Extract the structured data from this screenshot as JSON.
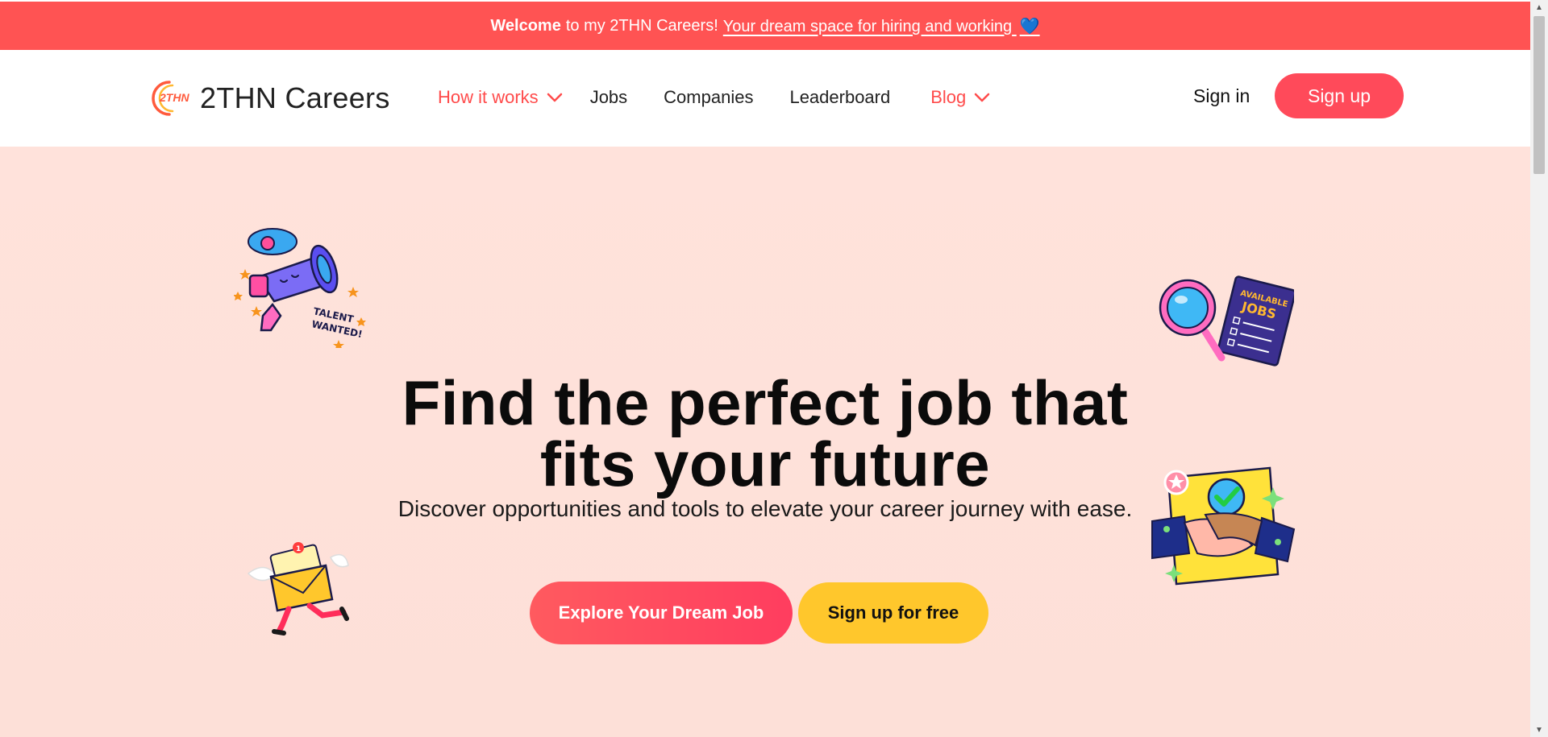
{
  "announcement": {
    "bold": "Welcome",
    "text": "to my 2THN Careers!",
    "link": "Your dream space for hiring and working",
    "heart": "💙"
  },
  "header": {
    "logo_text": "2THN Careers",
    "logo_mark": "2THN",
    "nav": [
      {
        "label": "How it works",
        "has_dropdown": true,
        "accent": true
      },
      {
        "label": "Jobs"
      },
      {
        "label": "Companies"
      },
      {
        "label": "Leaderboard"
      },
      {
        "label": "Blog",
        "has_dropdown": true,
        "accent": true
      }
    ],
    "signin": "Sign in",
    "signup": "Sign up"
  },
  "hero": {
    "title_line1": "Find the perfect job that",
    "title_line2": "fits your future",
    "subtitle": "Discover opportunities and tools to elevate your career journey with ease.",
    "cta_primary": "Explore Your Dream Job",
    "cta_secondary": "Sign up for free",
    "sticker_megaphone_text": "TALENT WANTED!",
    "sticker_jobs_text": "AVAILABLE JOBS",
    "mail_badge": "1"
  },
  "colors": {
    "brand": "#ff4b4b",
    "announcement_bg": "#ff5353",
    "signup_bg": "#ff4a5a",
    "hero_bg": "#ffe2db",
    "cta_secondary_bg": "#ffc72c"
  }
}
